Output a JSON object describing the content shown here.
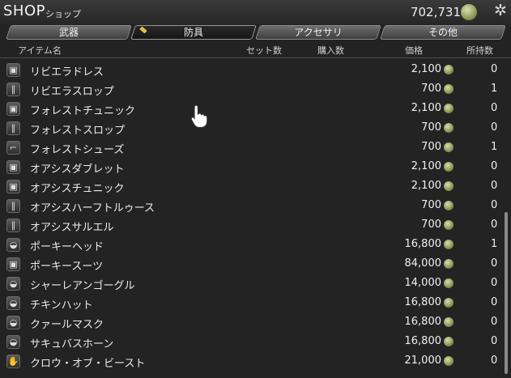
{
  "window": {
    "title": "SHOP",
    "subtitle": "ショップ",
    "gil": "702,731"
  },
  "tabs": [
    {
      "label": "武器",
      "active": false
    },
    {
      "label": "防具",
      "active": true
    },
    {
      "label": "アクセサリ",
      "active": false
    },
    {
      "label": "その他",
      "active": false
    }
  ],
  "columns": {
    "name": "アイテム名",
    "set_count": "セット数",
    "purchase_count": "購入数",
    "price": "価格",
    "owned": "所持数"
  },
  "items": [
    {
      "name": "リビエラドレス",
      "price": "2,100",
      "owned": "0",
      "icon": "body-armor-icon"
    },
    {
      "name": "リビエラスロップ",
      "price": "700",
      "owned": "1",
      "icon": "legs-armor-icon"
    },
    {
      "name": "フォレストチュニック",
      "price": "2,100",
      "owned": "0",
      "icon": "body-armor-icon"
    },
    {
      "name": "フォレストスロップ",
      "price": "700",
      "owned": "0",
      "icon": "legs-armor-icon"
    },
    {
      "name": "フォレストシューズ",
      "price": "700",
      "owned": "1",
      "icon": "boots-icon"
    },
    {
      "name": "オアシスダブレット",
      "price": "2,100",
      "owned": "0",
      "icon": "body-armor-icon"
    },
    {
      "name": "オアシスチュニック",
      "price": "2,100",
      "owned": "0",
      "icon": "body-armor-icon"
    },
    {
      "name": "オアシスハーフトルゥース",
      "price": "700",
      "owned": "0",
      "icon": "legs-armor-icon"
    },
    {
      "name": "オアシスサルエル",
      "price": "700",
      "owned": "0",
      "icon": "legs-armor-icon"
    },
    {
      "name": "ポーキーヘッド",
      "price": "16,800",
      "owned": "1",
      "icon": "head-armor-icon"
    },
    {
      "name": "ポーキースーツ",
      "price": "84,000",
      "owned": "0",
      "icon": "body-armor-icon"
    },
    {
      "name": "シャーレアンゴーグル",
      "price": "14,000",
      "owned": "0",
      "icon": "head-armor-icon"
    },
    {
      "name": "チキンハット",
      "price": "16,800",
      "owned": "0",
      "icon": "head-armor-icon"
    },
    {
      "name": "クァールマスク",
      "price": "16,800",
      "owned": "0",
      "icon": "head-armor-icon"
    },
    {
      "name": "サキュバスホーン",
      "price": "16,800",
      "owned": "0",
      "icon": "head-armor-icon"
    },
    {
      "name": "クロウ・オブ・ビースト",
      "price": "21,000",
      "owned": "0",
      "icon": "gloves-icon"
    }
  ],
  "colors": {
    "background": "#232323",
    "active_tab_marker": "#e2c04a",
    "coin": "#8f9a58"
  }
}
